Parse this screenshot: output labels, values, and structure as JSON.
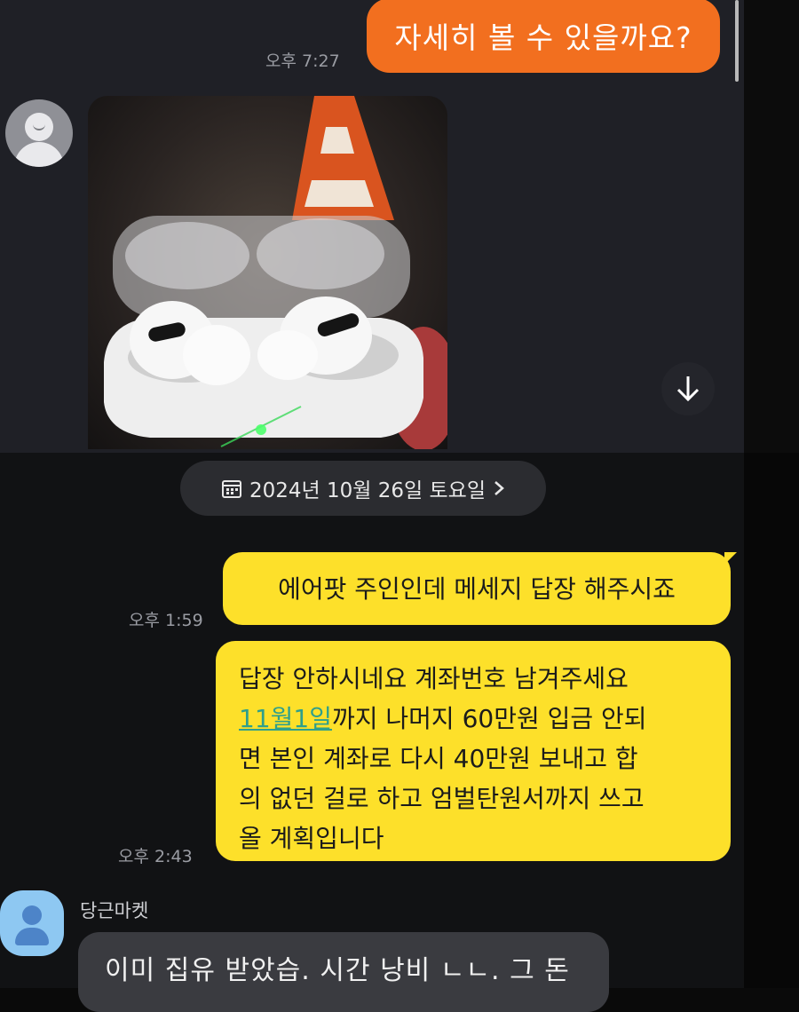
{
  "messages": {
    "outgoing_top": {
      "text": "자세히 볼 수 있을까요?",
      "time": "오후 7:27"
    },
    "date_divider": "2024년 10월 26일 토요일",
    "yellow_1": {
      "text": "에어팟 주인인데 메세지 답장 해주시죠",
      "time": "오후 1:59"
    },
    "yellow_2": {
      "line1": "답장 안하시네요 계좌번호 남겨주세요",
      "line2_link": "11월1일",
      "line2_rest": "까지 나머지 60만원 입금 안되",
      "line3": "면 본인 계좌로 다시 40만원 보내고 합",
      "line4": "의 없던 걸로 하고 엄벌탄원서까지 쓰고",
      "line5": "올 계획입니다",
      "time": "오후 2:43"
    },
    "incoming_bottom": {
      "sender": "당근마켓",
      "text": "이미 집유 받았습. 시간 낭비 ㄴㄴ. 그 돈"
    }
  },
  "icons": {
    "profile": "person-icon",
    "download": "arrow-down-icon",
    "calendar": "calendar-icon",
    "chevron": "chevron-right-icon"
  },
  "colors": {
    "orange_bubble": "#f26f1f",
    "yellow_bubble": "#fde02a",
    "link": "#2f9f8b",
    "sender_avatar": "#8ec8f2"
  }
}
